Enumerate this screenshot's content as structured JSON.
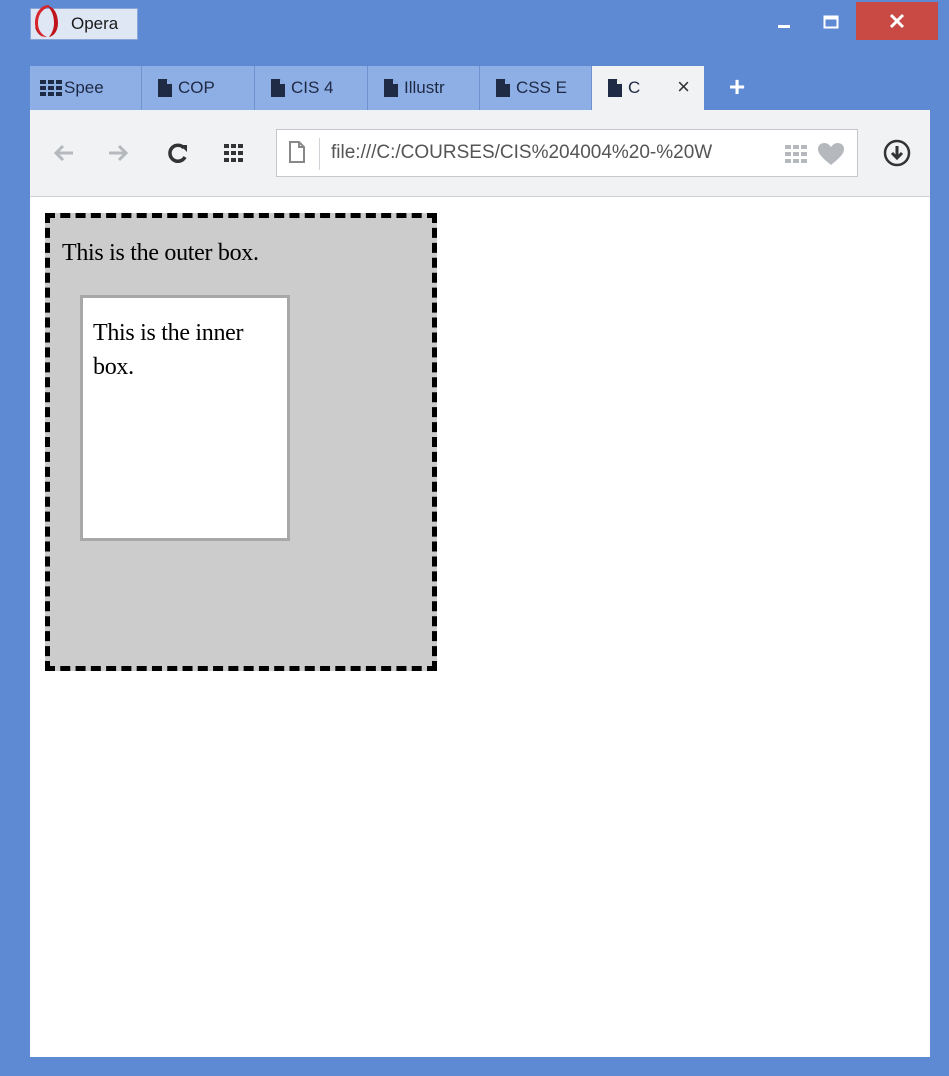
{
  "window": {
    "app_button_label": "Opera",
    "controls": {
      "minimize": "_",
      "maximize": "☐",
      "close": "×"
    },
    "colors": {
      "frame": "#5e8ad4",
      "close": "#c94a45",
      "tab": "#8eaee6",
      "active_tab": "#f1f2f4"
    }
  },
  "tabs": [
    {
      "label": "Spee",
      "icon": "speed-dial-icon"
    },
    {
      "label": "COP",
      "icon": "page-icon"
    },
    {
      "label": "CIS 4",
      "icon": "page-icon"
    },
    {
      "label": "Illustr",
      "icon": "page-icon"
    },
    {
      "label": "CSS E",
      "icon": "page-icon"
    },
    {
      "label": "C",
      "icon": "page-icon",
      "active": true,
      "close": "×"
    }
  ],
  "new_tab_label": "+",
  "toolbar": {
    "url": "file:///C:/COURSES/CIS%204004%20-%20W"
  },
  "page": {
    "outer_box_text": "This is the outer box.",
    "inner_box_text": "This is the inner box.",
    "outer_bg": "#cccccc"
  }
}
